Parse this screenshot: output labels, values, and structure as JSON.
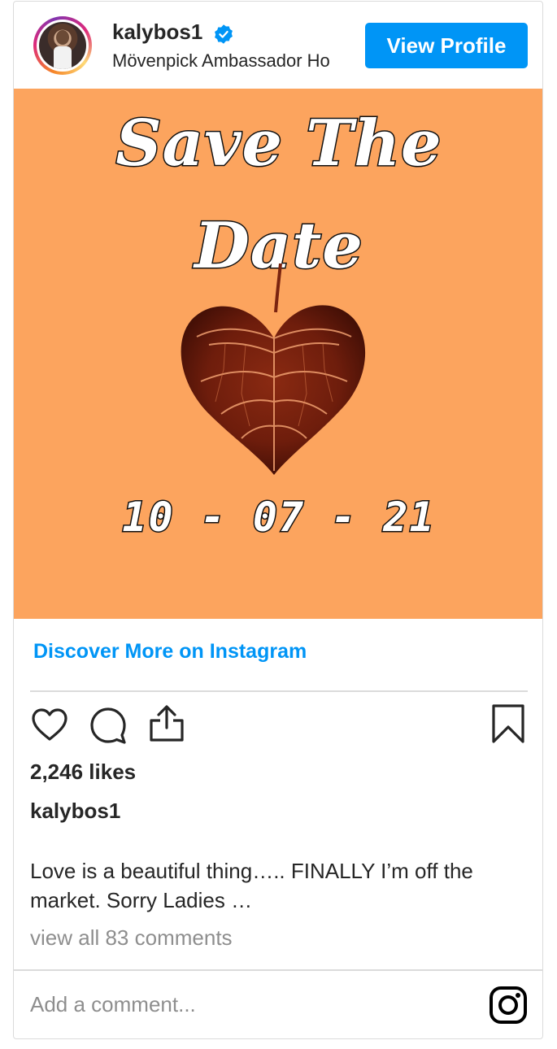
{
  "header": {
    "username": "kalybos1",
    "location": "Mövenpick Ambassador Ho",
    "view_profile_label": "View Profile"
  },
  "post_image": {
    "line1": "Save The",
    "line2": "Date",
    "date": "10 - 07 - 21",
    "background_color": "#fca45e"
  },
  "discover_label": "Discover More on Instagram",
  "actions": {
    "icons": [
      "heart-icon",
      "comment-icon",
      "share-icon",
      "bookmark-icon"
    ]
  },
  "likes": "2,246 likes",
  "caption": {
    "username": "kalybos1",
    "text": "Love is a beautiful thing….. FINALLY I’m off the market. Sorry Ladies …"
  },
  "view_comments": "view all 83 comments",
  "comment_input": {
    "placeholder": "Add a comment..."
  },
  "colors": {
    "accent": "#0095f6",
    "muted_text": "#8e8e8e",
    "border": "#dbdbdb"
  }
}
